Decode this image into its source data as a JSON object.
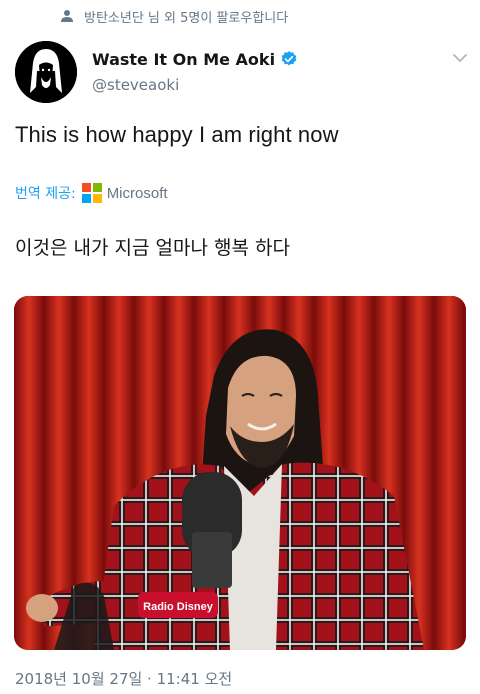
{
  "social_context": {
    "text": "방탄소년단 님 외 5명이 팔로우합니다",
    "icon": "person-icon"
  },
  "author": {
    "display_name": "Waste It On Me Aoki",
    "handle": "@steveaoki",
    "verified": true,
    "verified_color": "#1da1f2"
  },
  "tweet": {
    "text": "This is how happy I am right now",
    "translation_label": "번역 제공:",
    "translation_provider": "Microsoft",
    "translated_text": "이것은 내가 지금 얼마나 행복 하다",
    "media_mic_label": "Radio Disney",
    "timestamp": "2018년 10월 27일 · 11:41 오전"
  },
  "colors": {
    "accent": "#1da1f2",
    "muted": "#657786",
    "text": "#14171a",
    "ms_red": "#f25022",
    "ms_green": "#7fba00",
    "ms_blue": "#00a4ef",
    "ms_yellow": "#ffb900"
  }
}
